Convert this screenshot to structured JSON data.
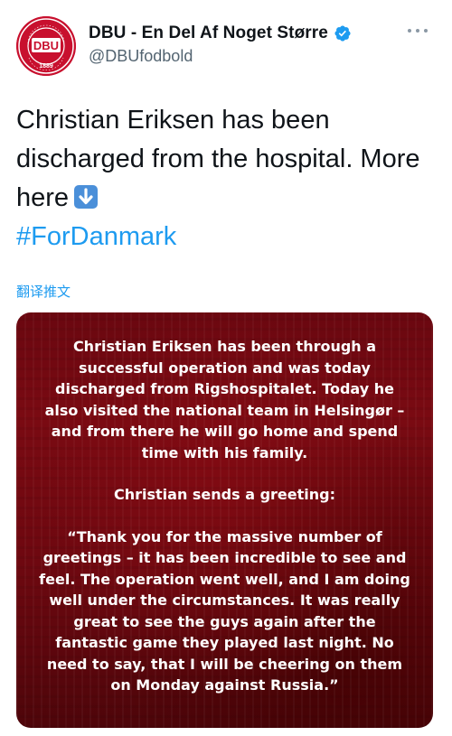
{
  "account": {
    "display_name": "DBU - En Del Af Noget Større",
    "handle": "@DBUfodbold",
    "logo_text": "DBU",
    "logo_ring_text": "DANSK BOLDSPIL UNION",
    "logo_year": "1889"
  },
  "tweet": {
    "text_main": "Christian Eriksen has been discharged from the hospital. More here",
    "hashtag": "#ForDanmark",
    "translate_label": "翻译推文"
  },
  "media": {
    "paragraph_1": "Christian Eriksen has been through a successful operation and was today discharged from Rigshospitalet. Today he also visited the national team in Helsingør – and from there he will go home and spend time with his family.",
    "paragraph_2": "Christian sends a greeting:",
    "paragraph_3": "“Thank you for the massive number of greetings – it has been incredible to see and feel. The operation went well, and I am doing well under the circumstances. It was really great to see the guys again after the fantastic game they played last night. No need to say, that I will be cheering on them on Monday against Russia.”"
  },
  "icons": {
    "verified": "verified-badge-icon",
    "more": "more-options-icon",
    "arrow": "down-arrow-emoji-icon"
  },
  "colors": {
    "link": "#1d9bf0",
    "brand_red": "#c8102e",
    "text": "#0f1419",
    "secondary": "#536471"
  }
}
